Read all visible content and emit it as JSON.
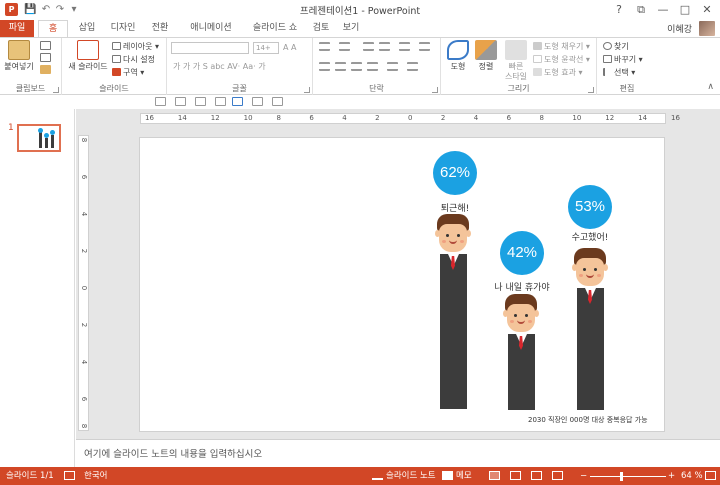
{
  "window": {
    "title": "프레젠테이션1 - PowerPoint",
    "app_icon": "P",
    "user": "이혜강",
    "controls": {
      "help": "?",
      "restore": "⧉",
      "minimize": "—",
      "maximize": "□",
      "close": "✕"
    }
  },
  "qat": {
    "save": "💾",
    "undo": "↶",
    "redo": "↷",
    "customize": "▾"
  },
  "tabs": [
    "파일",
    "홈",
    "삽입",
    "디자인",
    "전환",
    "애니메이션",
    "슬라이드 쇼",
    "검토",
    "보기"
  ],
  "ribbon": {
    "clipboard": {
      "label": "클립보드",
      "paste": "붙여넣기"
    },
    "slides": {
      "label": "슬라이드",
      "new_slide": "새 슬라이드",
      "layout": "레이아웃 ▾",
      "reset": "다시 설정",
      "section": "구역 ▾"
    },
    "font": {
      "label": "글꼴",
      "size_placeholder": "14+",
      "tools": "가 가 가 S abc AV· Aa· 가",
      "tools2": "가 가 가 가 가"
    },
    "paragraph": {
      "label": "단락"
    },
    "drawing": {
      "label": "그리기",
      "shapes": "도형",
      "arrange": "정렬",
      "quick_styles": "빠른\n스타일",
      "fill": "도형 채우기 ▾",
      "outline": "도형 윤곽선 ▾",
      "effects": "도형 효과 ▾"
    },
    "editing": {
      "label": "편집",
      "find": "찾기",
      "replace": "바꾸기 ▾",
      "select": "선택 ▾"
    }
  },
  "ruler": {
    "h_ticks": [
      "16",
      "14",
      "12",
      "10",
      "8",
      "6",
      "4",
      "2",
      "0",
      "2",
      "4",
      "6",
      "8",
      "10",
      "12",
      "14",
      "16"
    ],
    "v_ticks": [
      "8",
      "6",
      "4",
      "2",
      "0",
      "2",
      "4",
      "6",
      "8"
    ]
  },
  "thumbnail": {
    "number": "1"
  },
  "slide": {
    "people": [
      {
        "percent": "62%",
        "caption": "퇴근해!"
      },
      {
        "percent": "42%",
        "caption": "나 내일 휴가야"
      },
      {
        "percent": "53%",
        "caption": "수고했어!"
      }
    ],
    "footnote": "2030 직장인 000명 대상 중복응답 가능"
  },
  "notes": {
    "placeholder": "여기에 슬라이드 노트의 내용을 입력하십시오"
  },
  "status": {
    "slide_count": "슬라이드 1/1",
    "language": "한국어",
    "notes_btn": "슬라이드 노트",
    "comments_btn": "메모",
    "zoom_minus": "−",
    "zoom_plus": "+",
    "zoom": "64 %"
  },
  "colors": {
    "accent": "#d24726",
    "bubble": "#1ba1e2",
    "suit": "#3c3c3c",
    "tie": "#d9262c"
  }
}
